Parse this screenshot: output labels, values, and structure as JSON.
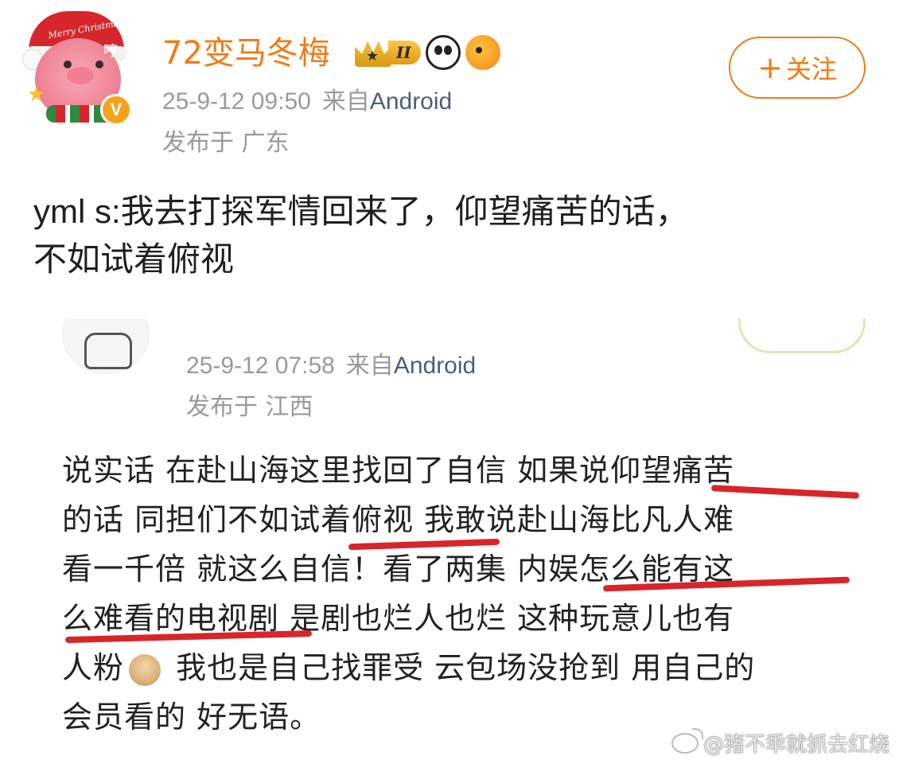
{
  "user": {
    "name": "72变马冬梅",
    "avatar_hat_text": "Merry Christmas",
    "avatar_side_text": "哼",
    "verified_mark": "V",
    "vip_level": "II",
    "post_time": "25-9-12 09:50",
    "from_label": "来自",
    "source": "Android",
    "location": "发布于 广东"
  },
  "follow_button": {
    "plus": "+",
    "label": "关注"
  },
  "post": {
    "prefix": "yml s:",
    "text_line1": "我去打探军情回来了，仰望痛苦的话，",
    "text_line2": "不如试着俯视"
  },
  "embedded": {
    "post_time": "25-9-12 07:58",
    "from_label": "来自",
    "source": "Android",
    "location": "发布于 江西",
    "lines": [
      "说实话 在赴山海这里找回了自信 如果说仰望痛苦",
      "的话 同担们不如试着俯视 我敢说赴山海比凡人难",
      "看一千倍 就这么自信！看了两集 内娱怎么能有这",
      "么难看的电视剧 是剧也烂人也烂 这种玩意儿也有"
    ],
    "line5_a": "人粉",
    "line5_b": " 我也是自己找罪受 云包场没抢到 用自己的",
    "line6": "会员看的 好无语。"
  },
  "watermark": "@猪不乖就抓去红烧",
  "colors": {
    "username": "#f07b12",
    "follow_border": "#f07b12",
    "meta_gray": "#9a9a9a",
    "source_blue": "#4d5c80",
    "underline_red": "#d8252a"
  }
}
